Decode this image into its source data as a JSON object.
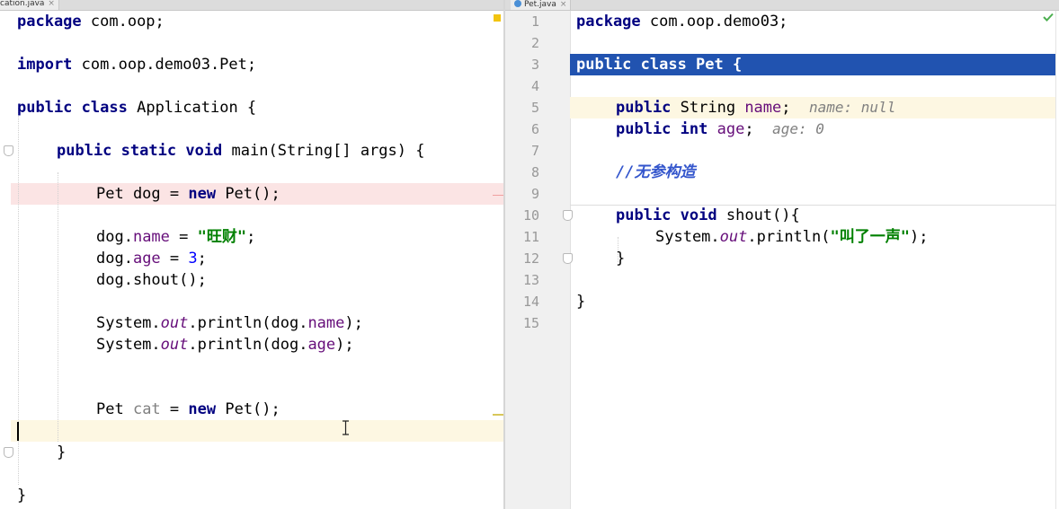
{
  "tabs": {
    "left": {
      "label": "cation.java",
      "close": "×"
    },
    "right": {
      "label": "Pet.java",
      "close": "×"
    }
  },
  "left_editor": {
    "lines": {
      "l1": {
        "kw": "package",
        "rest": " com.oop;"
      },
      "l3": {
        "kw": "import",
        "rest": " com.oop.demo03.Pet;"
      },
      "l5": {
        "kw1": "public",
        "kw2": "class",
        "rest": " Application {"
      },
      "l7": {
        "kw1": "public",
        "kw2": "static",
        "kw3": "void",
        "rest": " main(String[] args) {"
      },
      "l9": {
        "a": "Pet dog = ",
        "kw": "new",
        "b": " Pet();"
      },
      "l11": {
        "a": "dog.",
        "field": "name",
        "b": " = ",
        "str": "\"旺财\"",
        "c": ";"
      },
      "l12": {
        "a": "dog.",
        "field": "age",
        "b": " = ",
        "num": "3",
        "c": ";"
      },
      "l13": {
        "a": "dog.shout();"
      },
      "l15": {
        "a": "System.",
        "out": "out",
        "b": ".println(dog.",
        "field": "name",
        "c": ");"
      },
      "l16": {
        "a": "System.",
        "out": "out",
        "b": ".println(dog.",
        "field": "age",
        "c": ");"
      },
      "l19": {
        "a": "Pet ",
        "unused": "cat",
        "b": " = ",
        "kw": "new",
        "c": " Pet();"
      },
      "l21": {
        "a": "}"
      },
      "l23": {
        "a": "}"
      }
    }
  },
  "right_editor": {
    "line_numbers": [
      "1",
      "2",
      "3",
      "4",
      "5",
      "6",
      "7",
      "8",
      "9",
      "10",
      "11",
      "12",
      "13",
      "14",
      "15"
    ],
    "lines": {
      "r1": {
        "kw": "package",
        "rest": " com.oop.demo03;"
      },
      "r3": {
        "text": "public class Pet {"
      },
      "r5": {
        "kw": "public",
        "a": " String ",
        "field": "name",
        "b": ";",
        "hint": "name: null"
      },
      "r6": {
        "kw1": "public",
        "kw2": "int",
        "a": " ",
        "field": "age",
        "b": ";",
        "hint": "age: 0"
      },
      "r8": {
        "comment": "//无参构造"
      },
      "r10": {
        "kw1": "public",
        "kw2": "void",
        "a": " shout(){"
      },
      "r11": {
        "a": "System.",
        "out": "out",
        "b": ".println(",
        "str": "\"叫了一声\"",
        "c": ");"
      },
      "r12": {
        "a": "}"
      },
      "r14": {
        "a": "}"
      }
    }
  },
  "colors": {
    "selection": "#2153b0",
    "current_line": "#fdf7e2",
    "error_line": "#fbe4e4",
    "keyword": "#000080",
    "field": "#660e7a",
    "string": "#008000",
    "number": "#0000ff",
    "comment": "#3355cc"
  }
}
